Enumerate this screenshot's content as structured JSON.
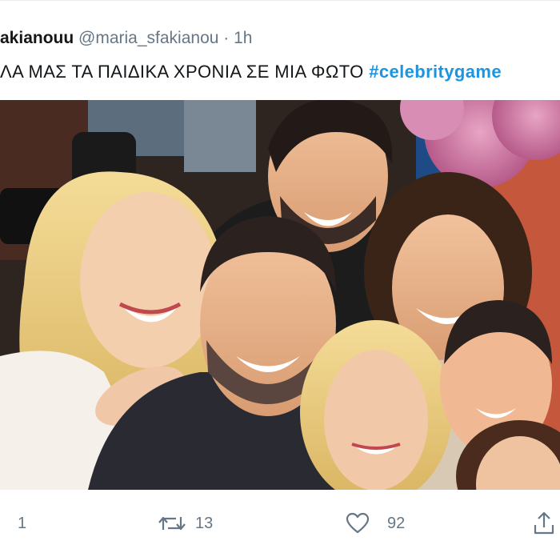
{
  "tweet": {
    "name": "akianouu",
    "handle": "@maria_sfakianou",
    "separator": "·",
    "time": "1h",
    "text": "ΛΑ ΜΑΣ ΤΑ ΠΑΙΔΙΚΑ ΧΡΟΝΙΑ ΣΕ ΜΙΑ ΦΩΤΟ ",
    "hashtag": "#celebritygame"
  },
  "actions": {
    "reply_count": "1",
    "retweet_count": "13",
    "like_count": "92"
  },
  "icons": {
    "reply": "reply-icon",
    "retweet": "retweet-icon",
    "like": "heart-icon",
    "share": "share-icon"
  },
  "colors": {
    "link": "#1b95e0",
    "secondary_text": "#657786"
  }
}
